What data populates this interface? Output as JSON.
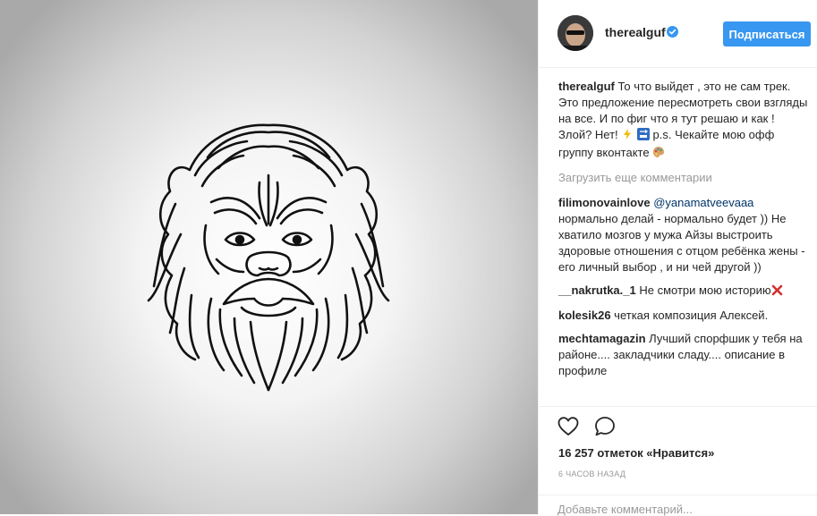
{
  "post": {
    "username": "therealguf",
    "follow_label": "Подписаться",
    "caption": {
      "username": "therealguf",
      "text": "То что выйдет , это не сам трек. Это предложение пересмотреть свои взгляды на все. И по фиг что я тут решаю и как ! Злой? Нет!",
      "text_after_emoji": "p.s. Чекайте мою офф группу вконтакте"
    },
    "load_more": "Загрузить еще комментарии",
    "comments": [
      {
        "username": "filimonovainlove",
        "mention": "@yanamatveevaaa",
        "text": "нормально делай - нормально будет )) Не хватило мозгов у мужа Айзы выстроить здоровые отношения с отцом ребёнка жены - его личный выбор , и ни чей другой ))"
      },
      {
        "username": "__nakrutka._1",
        "text": "Не смотри мою историю"
      },
      {
        "username": "kolesik26",
        "text": "четкая композиция Алексей."
      },
      {
        "username": "mechtamagazin",
        "text": "Лучший спорфшик у тебя на районе.... закладчики сладу.... описание в профиле"
      }
    ],
    "likes": "16 257 отметок «Нравится»",
    "time": "6 часов назад",
    "add_comment_placeholder": "Добавьте комментарий..."
  },
  "icons": {
    "verified": "verified-badge-icon",
    "like": "heart-icon",
    "comment": "comment-bubble-icon",
    "lightning": "lightning-emoji",
    "soon": "soon-arrow-emoji",
    "palette": "palette-emoji",
    "cross": "cross-mark-emoji"
  },
  "colors": {
    "follow_button": "#3897f0",
    "mention": "#003569",
    "muted": "#999999",
    "text": "#262626"
  }
}
